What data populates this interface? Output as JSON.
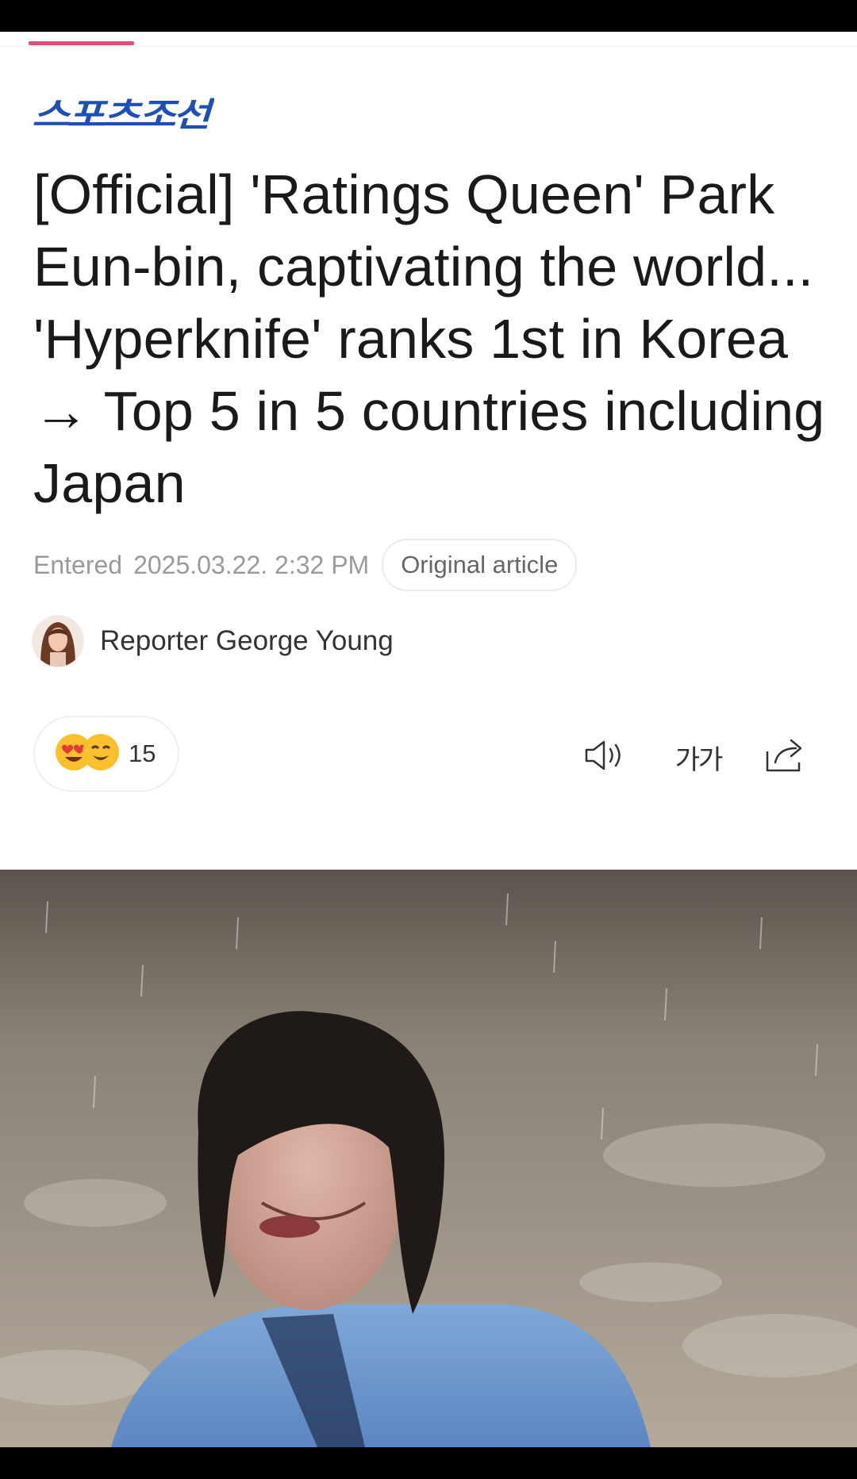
{
  "publisher": {
    "logo_text": "스포츠조선",
    "logo_color": "#1e4fb4"
  },
  "article": {
    "headline": "[Official] 'Ratings Queen' Park Eun-bin, captivating the world... 'Hyperknife' ranks 1st in Korea → Top 5 in 5 countries including Japan",
    "entered_label": "Entered",
    "entered_date": "2025.03.22. 2:32 PM",
    "original_article_label": "Original article"
  },
  "reporter": {
    "name": "Reporter George Young"
  },
  "reactions": {
    "count": "15",
    "emojis": [
      "heart-eyes-emoji",
      "smirk-emoji"
    ]
  },
  "toolbar": {
    "font_size_label": "가가",
    "icons": [
      "speaker-icon",
      "font-size-icon",
      "share-icon"
    ]
  },
  "colors": {
    "accent": "#e0507a",
    "headline": "#1a1a1a",
    "meta": "#9a9a9a"
  }
}
